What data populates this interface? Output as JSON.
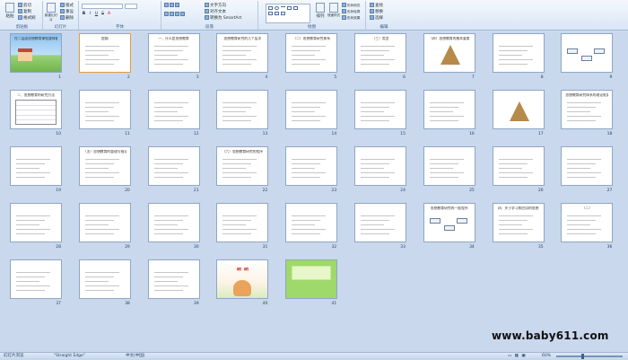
{
  "ribbon": {
    "clipboard": {
      "paste": "粘贴",
      "cut": "剪切",
      "copy": "复制",
      "format_painter": "格式刷",
      "group_label": "剪贴板"
    },
    "slides": {
      "new_slide": "新建幻灯片",
      "layout": "版式",
      "reset": "重设",
      "delete": "删除",
      "group_label": "幻灯片"
    },
    "font": {
      "group_label": "字体",
      "format_glyphs": [
        "B",
        "I",
        "U",
        "S",
        "A"
      ]
    },
    "paragraph": {
      "text_direction": "文字方向",
      "align_text": "对齐文本",
      "smartart": "转换为 SmartArt",
      "group_label": "段落"
    },
    "drawing": {
      "arrange": "排列",
      "quick_styles": "快速样式",
      "shape_fill": "形状填充",
      "shape_outline": "形状轮廓",
      "shape_effects": "形状效果",
      "group_label": "绘图"
    },
    "editing": {
      "find": "查找",
      "replace": "替换",
      "select": "选择",
      "group_label": "编辑"
    }
  },
  "slides": [
    {
      "n": "1",
      "title": "在二层面思想教育课程整体备课",
      "kind": "cover"
    },
    {
      "n": "2",
      "title": "提纲",
      "kind": "text"
    },
    {
      "n": "3",
      "title": "一、什么是思想教育",
      "kind": "text"
    },
    {
      "n": "4",
      "title": "思想教育研究的几个层次",
      "kind": "text"
    },
    {
      "n": "5",
      "title": "（二）思想教育研究体系",
      "kind": "text"
    },
    {
      "n": "6",
      "title": "（三）类型",
      "kind": "text"
    },
    {
      "n": "7",
      "title": "（四）思想教育的基本要素",
      "kind": "pyramid"
    },
    {
      "n": "8",
      "title": "",
      "kind": "text"
    },
    {
      "n": "9",
      "title": "",
      "kind": "diagram"
    },
    {
      "n": "10",
      "title": "二、思想教育的研究方法",
      "kind": "table"
    },
    {
      "n": "11",
      "title": "",
      "kind": "text"
    },
    {
      "n": "12",
      "title": "",
      "kind": "text"
    },
    {
      "n": "13",
      "title": "",
      "kind": "text"
    },
    {
      "n": "14",
      "title": "",
      "kind": "text"
    },
    {
      "n": "15",
      "title": "",
      "kind": "text"
    },
    {
      "n": "16",
      "title": "",
      "kind": "text"
    },
    {
      "n": "17",
      "title": "",
      "kind": "pyramid"
    },
    {
      "n": "18",
      "title": "思想教育研究体系的理论框架",
      "kind": "text"
    },
    {
      "n": "19",
      "title": "",
      "kind": "text"
    },
    {
      "n": "20",
      "title": "（五）思想教育的管理与指导",
      "kind": "text"
    },
    {
      "n": "21",
      "title": "",
      "kind": "text"
    },
    {
      "n": "22",
      "title": "（六）思想教育研究的程序",
      "kind": "text"
    },
    {
      "n": "23",
      "title": "",
      "kind": "text"
    },
    {
      "n": "24",
      "title": "",
      "kind": "text"
    },
    {
      "n": "25",
      "title": "",
      "kind": "text"
    },
    {
      "n": "26",
      "title": "",
      "kind": "text"
    },
    {
      "n": "27",
      "title": "",
      "kind": "text"
    },
    {
      "n": "28",
      "title": "",
      "kind": "text"
    },
    {
      "n": "29",
      "title": "",
      "kind": "text"
    },
    {
      "n": "30",
      "title": "",
      "kind": "text"
    },
    {
      "n": "31",
      "title": "",
      "kind": "text"
    },
    {
      "n": "32",
      "title": "",
      "kind": "text"
    },
    {
      "n": "33",
      "title": "",
      "kind": "text"
    },
    {
      "n": "34",
      "title": "思想教育研究的一般程序",
      "kind": "flow"
    },
    {
      "n": "35",
      "title": "四、关于学习和应用的思想",
      "kind": "text"
    },
    {
      "n": "36",
      "title": "（二）",
      "kind": "text"
    },
    {
      "n": "37",
      "title": "",
      "kind": "text"
    },
    {
      "n": "38",
      "title": "",
      "kind": "text"
    },
    {
      "n": "39",
      "title": "",
      "kind": "text"
    },
    {
      "n": "40",
      "title": "谢 谢",
      "kind": "thanks"
    },
    {
      "n": "41",
      "title": "",
      "kind": "green"
    }
  ],
  "status": {
    "view_label": "幻灯片浏览",
    "theme": "\"Straight Edge\"",
    "language": "中文(中国)",
    "zoom": "60%"
  },
  "watermark": "www.baby611.com",
  "colors": {
    "accent": "#e59a3b",
    "ribbon": "#d9e6f6",
    "sorter_bg": "#c9d8ed"
  }
}
